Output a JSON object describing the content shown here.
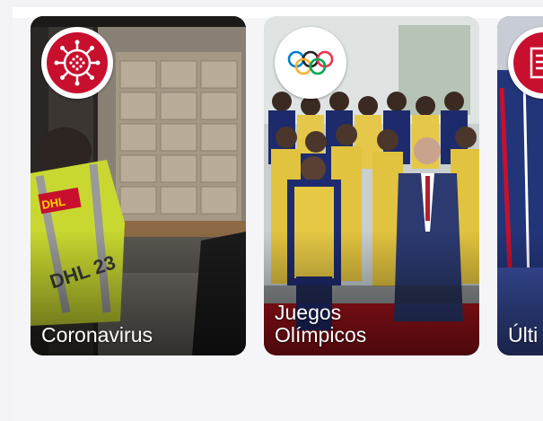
{
  "carousel": {
    "cards": [
      {
        "title": "Coronavirus",
        "icon": "coronavirus-icon",
        "badge_color": "#c8102e"
      },
      {
        "title": "Juegos\nOlímpicos",
        "icon": "olympic-rings-icon",
        "badge_color": "#ffffff"
      },
      {
        "title": "Últi\nnoti",
        "icon": "newspaper-icon",
        "badge_color": "#c8102e"
      }
    ]
  }
}
